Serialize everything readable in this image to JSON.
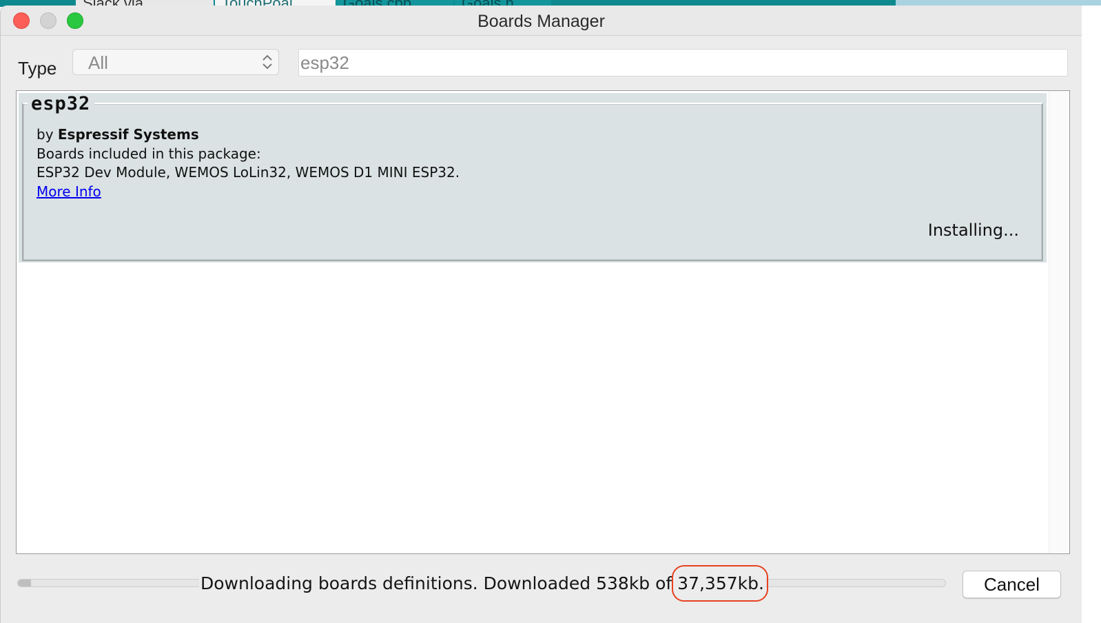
{
  "background_app": {
    "tabs": [
      "Slack via",
      "TouchPoal",
      "Goals.cpp",
      "Goals.h"
    ]
  },
  "window": {
    "title": "Boards Manager"
  },
  "filter": {
    "type_label": "Type",
    "type_value": "All",
    "search_value": "esp32"
  },
  "package": {
    "name": "esp32",
    "by_prefix": "by",
    "author": "Espressif Systems",
    "boards_heading": "Boards included in this package:",
    "boards": "ESP32 Dev Module, WEMOS LoLin32, WEMOS D1 MINI ESP32.",
    "more_info": "More Info",
    "status": "Installing..."
  },
  "footer": {
    "status_prefix": "Downloading boards definitions. Downloaded 538kb of",
    "status_total": "37,357kb.",
    "progress_fraction": 0.014,
    "cancel_label": "Cancel"
  },
  "colors": {
    "accent_highlight": "#e8401f",
    "link": "#0000ee",
    "package_bg": "#dbe2e3"
  }
}
